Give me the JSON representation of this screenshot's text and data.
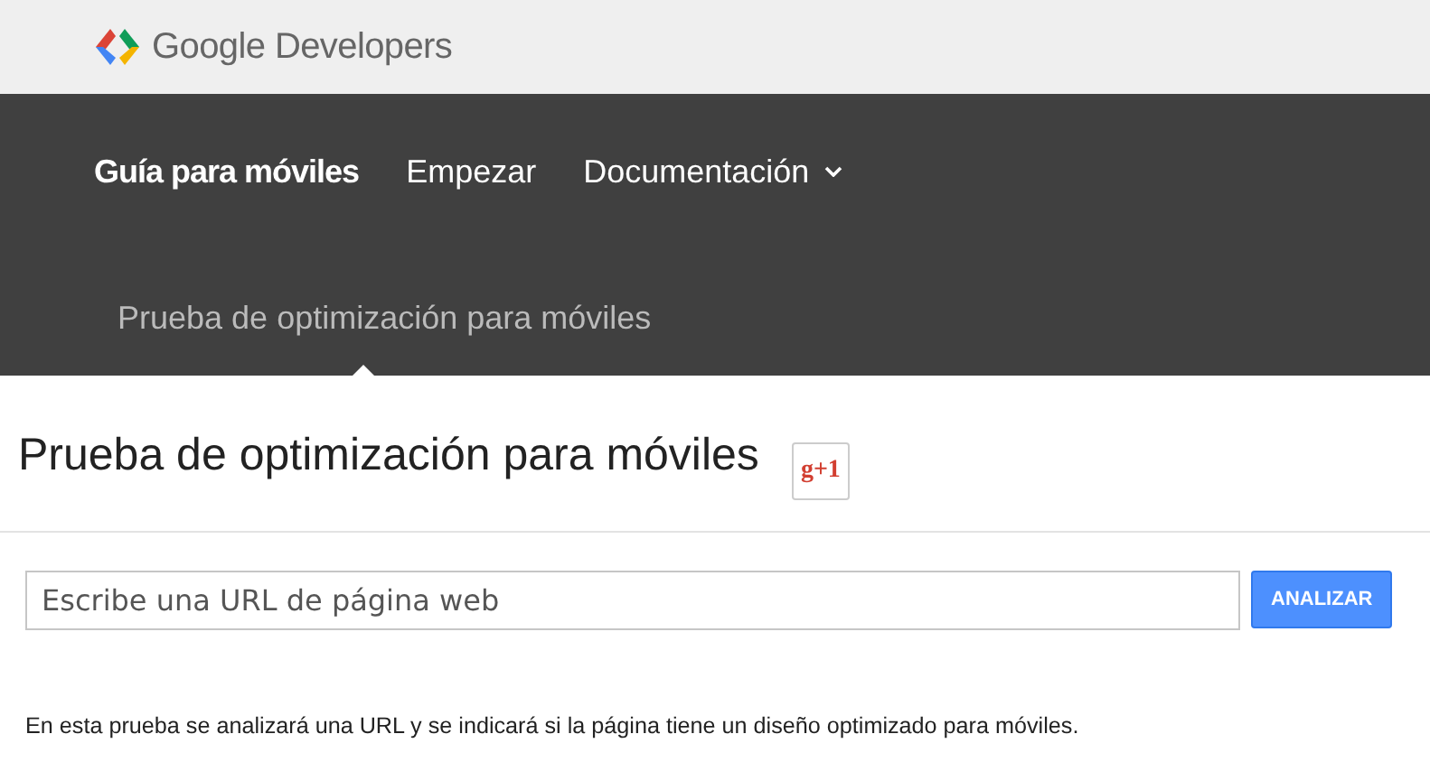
{
  "header": {
    "logo_text": "Google Developers"
  },
  "nav": [
    {
      "label": "Guía para móviles",
      "selected": true,
      "kind": "link"
    },
    {
      "label": "Empezar",
      "selected": false,
      "kind": "link"
    },
    {
      "label": "Documentación",
      "selected": false,
      "kind": "dropdown"
    }
  ],
  "subnav": {
    "label": "Prueba de optimización para móviles"
  },
  "page": {
    "title": "Prueba de optimización para móviles",
    "plus_button": "g+1"
  },
  "url_form": {
    "placeholder": "Escribe una URL de página web",
    "button": "ANALIZAR"
  },
  "description": "En esta prueba se analizará una URL y se indicará si la página tiene un diseño optimizado para móviles."
}
